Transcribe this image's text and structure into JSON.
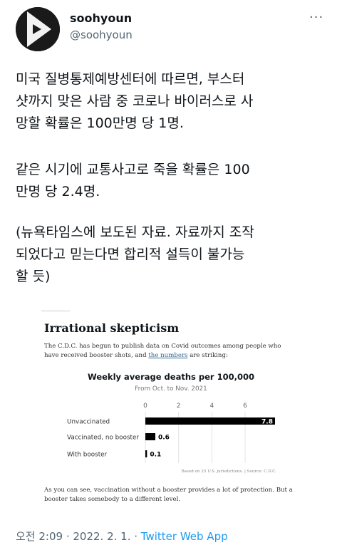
{
  "user": {
    "name": "soohyoun",
    "handle": "@soohyoun"
  },
  "more": "···",
  "tweet": {
    "p1": "미국 질병통제예방센터에 따르면, 부스터\n샷까지 맞은 사람 중 코로나 바이러스로 사\n망할 확률은 100만명 당 1명.",
    "p2": "같은 시기에 교통사고로 죽을 확률은 100\n만명 당 2.4명.",
    "p3": "(뉴욕타임스에 보도된 자료. 자료까지 조작\n되었다고 믿는다면 합리적 설득이 불가능\n할 듯)"
  },
  "article": {
    "title": "Irrational skepticism",
    "desc_a": "The C.D.C. has begun to publish data on Covid outcomes among people who have received booster shots, and ",
    "desc_link": "the numbers",
    "desc_b": " are striking:",
    "note": "As you can see, vaccination without a booster provides a lot of protection. But a booster takes somebody to a different level.",
    "source": "Based on 25 U.S. jurisdictions. | Source: C.D.C."
  },
  "chart_data": {
    "type": "bar",
    "orientation": "horizontal",
    "title": "Weekly average deaths per 100,000",
    "subtitle": "From Oct. to Nov. 2021",
    "categories": [
      "Unvaccinated",
      "Vaccinated, no booster",
      "With booster"
    ],
    "values": [
      7.8,
      0.6,
      0.1
    ],
    "value_labels": [
      "7.8",
      "0.6",
      "0.1"
    ],
    "xticks": [
      0,
      2,
      4,
      6
    ],
    "xlim": [
      0,
      7.8
    ],
    "bar_color": "#000000",
    "grid": true
  },
  "meta": {
    "time": "오전 2:09",
    "sep1": " · ",
    "date": "2022. 2. 1.",
    "sep2": " · ",
    "app": "Twitter Web App"
  }
}
